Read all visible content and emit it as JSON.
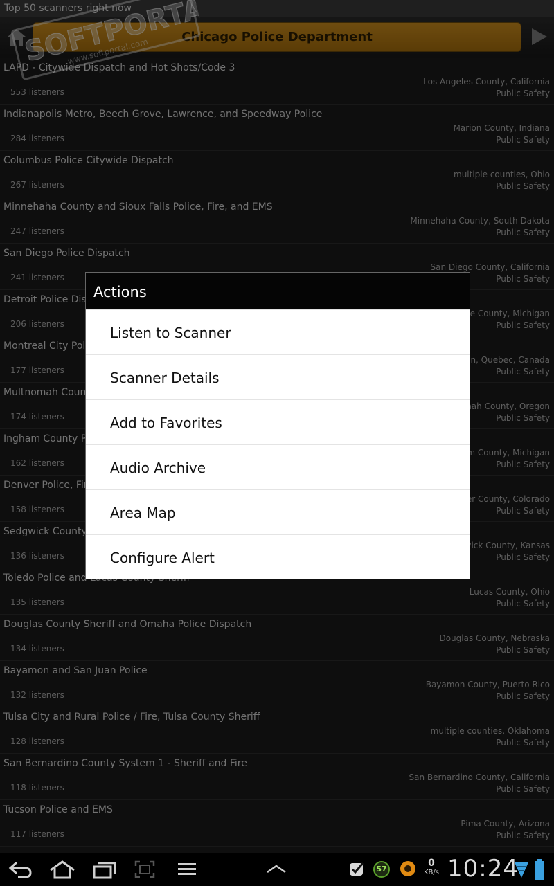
{
  "topbar": {
    "title": "Top 50 scanners right now"
  },
  "header": {
    "title": "Chicago Police Department"
  },
  "scanners": [
    {
      "name": "LAPD - Citywide Dispatch and Hot Shots/Code 3",
      "listeners": "553 listeners",
      "location": "Los Angeles County, California",
      "category": "Public Safety"
    },
    {
      "name": "Indianapolis Metro, Beech Grove, Lawrence, and Speedway Police",
      "listeners": "284 listeners",
      "location": "Marion County, Indiana",
      "category": "Public Safety"
    },
    {
      "name": "Columbus Police Citywide Dispatch",
      "listeners": "267 listeners",
      "location": "multiple counties, Ohio",
      "category": "Public Safety"
    },
    {
      "name": "Minnehaha County and Sioux Falls Police, Fire, and EMS",
      "listeners": "247 listeners",
      "location": "Minnehaha County, South Dakota",
      "category": "Public Safety"
    },
    {
      "name": "San Diego Police Dispatch",
      "listeners": "241 listeners",
      "location": "San Diego County, California",
      "category": "Public Safety"
    },
    {
      "name": "Detroit Police Dispatch",
      "listeners": "206 listeners",
      "location": "Wayne County, Michigan",
      "category": "Public Safety"
    },
    {
      "name": "Montreal City Police",
      "listeners": "177 listeners",
      "location": "Region, Quebec, Canada",
      "category": "Public Safety"
    },
    {
      "name": "Multnomah County",
      "listeners": "174 listeners",
      "location": "Multnomah County, Oregon",
      "category": "Public Safety"
    },
    {
      "name": "Ingham County P",
      "listeners": "162 listeners",
      "location": "Ingham County, Michigan",
      "category": "Public Safety"
    },
    {
      "name": "Denver Police, Fir",
      "listeners": "158 listeners",
      "location": "Denver County, Colorado",
      "category": "Public Safety"
    },
    {
      "name": "Sedgwick County",
      "listeners": "136 listeners",
      "location": "Sedgwick County, Kansas",
      "category": "Public Safety"
    },
    {
      "name": "Toledo Police and Lucas County Sheriff",
      "listeners": "135 listeners",
      "location": "Lucas County, Ohio",
      "category": "Public Safety"
    },
    {
      "name": "Douglas County Sheriff and Omaha Police Dispatch",
      "listeners": "134 listeners",
      "location": "Douglas County, Nebraska",
      "category": "Public Safety"
    },
    {
      "name": "Bayamon and San Juan Police",
      "listeners": "132 listeners",
      "location": "Bayamon County, Puerto Rico",
      "category": "Public Safety"
    },
    {
      "name": "Tulsa City and Rural Police / Fire, Tulsa County Sheriff",
      "listeners": "128 listeners",
      "location": "multiple counties, Oklahoma",
      "category": "Public Safety"
    },
    {
      "name": "San Bernardino County System 1 - Sheriff and Fire",
      "listeners": "118 listeners",
      "location": "San Bernardino County, California",
      "category": "Public Safety"
    },
    {
      "name": "Tucson Police and EMS",
      "listeners": "117 listeners",
      "location": "Pima County, Arizona",
      "category": "Public Safety"
    }
  ],
  "dialog": {
    "title": "Actions",
    "items": [
      "Listen to Scanner",
      "Scanner Details",
      "Add to Favorites",
      "Audio Archive",
      "Area Map",
      "Configure Alert"
    ]
  },
  "watermark": {
    "brand": "SOFTPORTAL",
    "url": "www.softportal.com",
    "tm": "TM"
  },
  "statusbar": {
    "time": "10:24",
    "net_speed": "0",
    "net_unit": "KB/s",
    "badge_count": "57",
    "icons": [
      "back-icon",
      "home-icon",
      "recent-apps-icon",
      "screenshot-icon",
      "menu-icon",
      "chevron-up-icon",
      "task-check-icon",
      "orange-app-icon",
      "wifi-icon",
      "battery-icon"
    ]
  },
  "colors": {
    "accent": "#b87a14",
    "background": "#1b1b1b",
    "dialog_title": "#050505"
  }
}
